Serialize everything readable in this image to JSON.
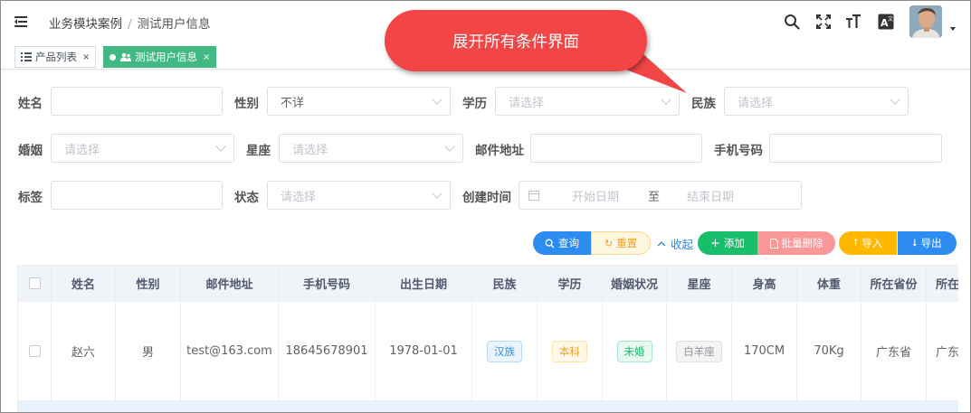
{
  "header": {
    "breadcrumb": [
      "业务模块案例",
      "测试用户信息"
    ],
    "icons": [
      "menu-fold-icon",
      "search-icon",
      "fullscreen-icon",
      "font-size-icon",
      "translate-icon",
      "avatar",
      "caret-down-icon"
    ]
  },
  "tags": [
    {
      "label": "产品列表",
      "icon": "list-icon",
      "active": false,
      "close": "×"
    },
    {
      "label": "测试用户信息",
      "icon": "users-icon",
      "active": true,
      "close": "×"
    }
  ],
  "callout": {
    "text": "展开所有条件界面"
  },
  "form": {
    "name": {
      "label": "姓名",
      "value": ""
    },
    "gender": {
      "label": "性别",
      "value": "不详"
    },
    "education": {
      "label": "学历",
      "placeholder": "请选择"
    },
    "ethnicity": {
      "label": "民族",
      "placeholder": "请选择"
    },
    "marital": {
      "label": "婚姻",
      "placeholder": "请选择"
    },
    "zodiac": {
      "label": "星座",
      "placeholder": "请选择"
    },
    "email": {
      "label": "邮件地址",
      "value": ""
    },
    "phone": {
      "label": "手机号码",
      "value": ""
    },
    "tag": {
      "label": "标签",
      "value": ""
    },
    "status": {
      "label": "状态",
      "placeholder": "请选择"
    },
    "created": {
      "label": "创建时间",
      "start_placeholder": "开始日期",
      "separator": "至",
      "end_placeholder": "结束日期"
    }
  },
  "actions": {
    "query": "查询",
    "reset": "重置",
    "collapse": "收起",
    "add": "添加",
    "batch_delete": "批量删除",
    "import": "导入",
    "export": "导出"
  },
  "colors": {
    "primary": "#2d8cf0",
    "success": "#19be6b",
    "tag_active": "#42b983",
    "warning": "#ff9900",
    "danger_light": "#f89898",
    "callout": "#f24646"
  },
  "table": {
    "columns": [
      "姓名",
      "性别",
      "邮件地址",
      "手机号码",
      "出生日期",
      "民族",
      "学历",
      "婚姻状况",
      "星座",
      "身高",
      "体重",
      "所在省份",
      "所在"
    ],
    "rows": [
      {
        "name": "赵六",
        "gender": "男",
        "email": "test@163.com",
        "phone": "18645678901",
        "birthday": "1978-01-01",
        "ethnicity": "汉族",
        "education": "本科",
        "marital": "未婚",
        "zodiac": "白羊座",
        "height": "170CM",
        "weight": "70Kg",
        "province": "广东省",
        "city": "广东"
      }
    ]
  }
}
